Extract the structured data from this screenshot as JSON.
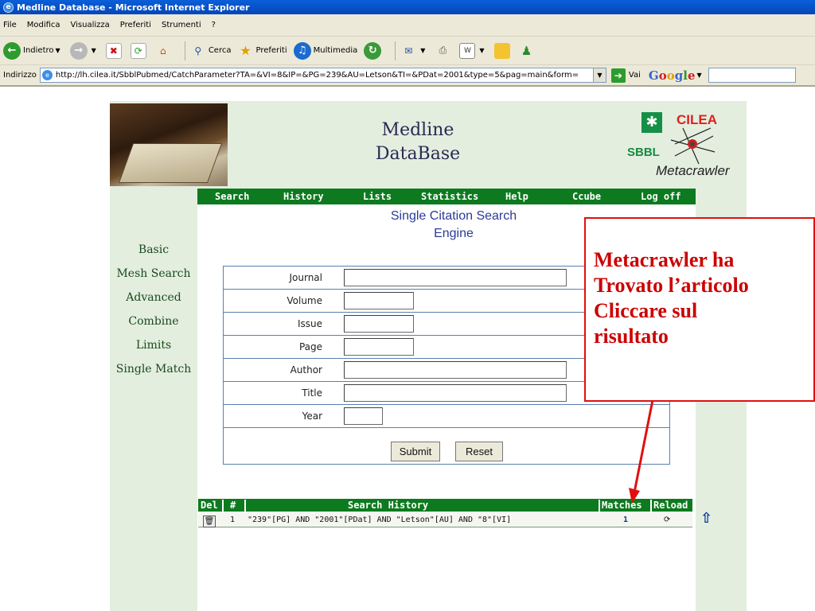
{
  "window": {
    "title": "Medline Database - Microsoft Internet Explorer"
  },
  "menu": [
    "File",
    "Modifica",
    "Visualizza",
    "Preferiti",
    "Strumenti",
    "?"
  ],
  "toolbar": {
    "back": "Indietro",
    "search": "Cerca",
    "favorites": "Preferiti",
    "media": "Multimedia"
  },
  "address": {
    "label": "Indirizzo",
    "url": "http://lh.cilea.it/SbblPubmed/CatchParameter?TA=&VI=8&IP=&PG=239&AU=Letson&TI=&PDat=2001&type=5&pag=main&form=",
    "go": "Vai",
    "google": "Google"
  },
  "header": {
    "title_line1": "Medline",
    "title_line2": "DataBase",
    "logo_cilea": "CILEA",
    "logo_sbbl": "SBBL",
    "logo_meta": "Metacrawler"
  },
  "nav": [
    "Search",
    "History",
    "Lists",
    "Statistics",
    "Help",
    "Ccube",
    "Log off"
  ],
  "engine": {
    "line1": "Single Citation Search",
    "line2": "Engine"
  },
  "leftmenu": [
    "Basic",
    "Mesh Search",
    "Advanced",
    "Combine",
    "Limits",
    "Single Match"
  ],
  "form": {
    "fields": [
      {
        "label": "Journal",
        "value": ""
      },
      {
        "label": "Volume",
        "value": ""
      },
      {
        "label": "Issue",
        "value": ""
      },
      {
        "label": "Page",
        "value": ""
      },
      {
        "label": "Author",
        "value": ""
      },
      {
        "label": "Title",
        "value": ""
      },
      {
        "label": "Year",
        "value": ""
      }
    ],
    "submit": "Submit",
    "reset": "Reset"
  },
  "history": {
    "headers": {
      "del": "Del",
      "num": "#",
      "search": "Search History",
      "matches": "Matches",
      "reload": "Reload"
    },
    "rows": [
      {
        "num": "1",
        "query": "\"239\"[PG] AND \"2001\"[PDat] AND \"Letson\"[AU] AND \"8\"[VI]",
        "matches": "1"
      }
    ]
  },
  "callout": {
    "line1": "Metacrawler ha",
    "line2": "Trovato l’articolo",
    "line3": "Cliccare sul",
    "line4": "risultato"
  },
  "colors": {
    "nav_green": "#0d7a1f",
    "panel_green": "#e3eedf",
    "callout_red": "#cc0000"
  }
}
